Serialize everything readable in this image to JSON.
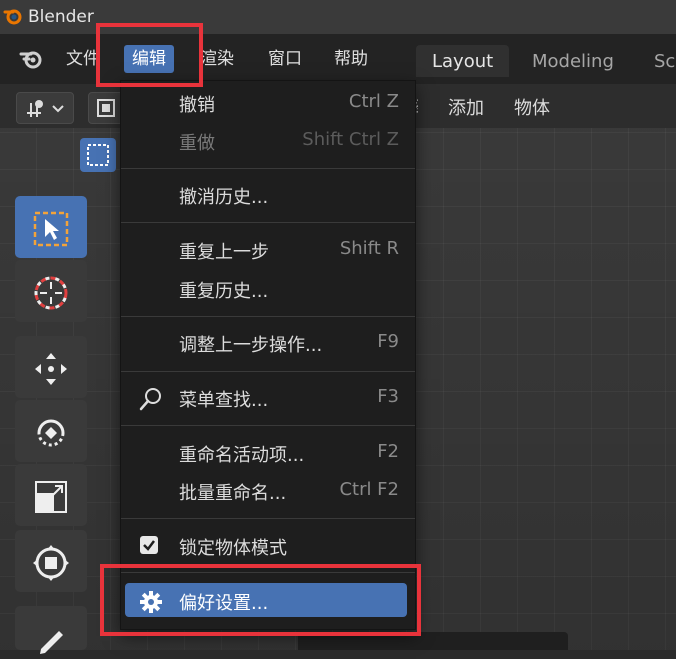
{
  "app": {
    "title": "Blender"
  },
  "menubar": {
    "items": [
      {
        "label": "文件"
      },
      {
        "label": "编辑"
      },
      {
        "label": "渲染"
      },
      {
        "label": "窗口"
      },
      {
        "label": "帮助"
      }
    ]
  },
  "workspaces": {
    "tabs": [
      {
        "label": "Layout"
      },
      {
        "label": "Modeling"
      },
      {
        "label": "Sc"
      }
    ]
  },
  "viewport_header": {
    "menus": [
      {
        "label": "添加"
      },
      {
        "label": "物体"
      }
    ]
  },
  "edit_menu": {
    "items": [
      {
        "label": "撤销",
        "shortcut": "Ctrl Z",
        "enabled": true
      },
      {
        "label": "重做",
        "shortcut": "Shift Ctrl Z",
        "enabled": false
      },
      {
        "label": "撤消历史...",
        "shortcut": "",
        "enabled": true
      },
      {
        "label": "重复上一步",
        "shortcut": "Shift R",
        "enabled": true
      },
      {
        "label": "重复历史...",
        "shortcut": "",
        "enabled": true
      },
      {
        "label": "调整上一步操作...",
        "shortcut": "F9",
        "enabled": true
      },
      {
        "label": "菜单查找...",
        "shortcut": "F3",
        "enabled": true
      },
      {
        "label": "重命名活动项...",
        "shortcut": "F2",
        "enabled": true
      },
      {
        "label": "批量重命名...",
        "shortcut": "Ctrl F2",
        "enabled": true
      },
      {
        "label": "锁定物体模式",
        "shortcut": "",
        "enabled": true
      },
      {
        "label": "偏好设置...",
        "shortcut": "",
        "enabled": true
      }
    ]
  },
  "colors": {
    "accent": "#4772b3",
    "highlight_box": "#e8333b",
    "menu_bg": "#1e1e1e"
  },
  "icons": {
    "app_logo": "blender-logo-icon",
    "search": "search-icon",
    "checkbox": "checkbox-checked-icon",
    "preferences": "gear-icon"
  }
}
